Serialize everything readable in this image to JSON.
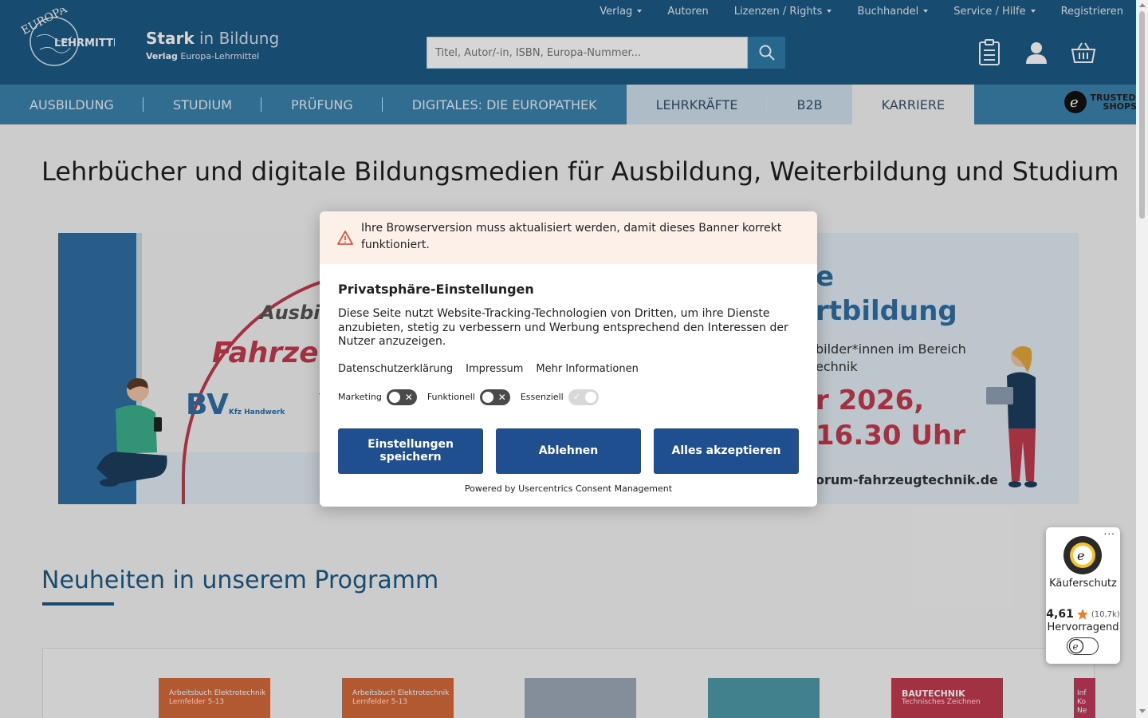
{
  "header": {
    "topnav": [
      {
        "label": "Verlag",
        "dropdown": true
      },
      {
        "label": "Autoren",
        "dropdown": false
      },
      {
        "label": "Lizenzen / Rights",
        "dropdown": true
      },
      {
        "label": "Buchhandel",
        "dropdown": true
      },
      {
        "label": "Service / Hilfe",
        "dropdown": true
      },
      {
        "label": "Registrieren",
        "dropdown": false
      }
    ],
    "logo_text": "EUROPA LEHRMITTEL",
    "brand_title_bold": "Stark",
    "brand_title_rest": " in Bildung",
    "brand_sub_bold": "Verlag",
    "brand_sub_rest": " Europa-Lehrmittel",
    "search_placeholder": "Titel, Autor/-in, ISBN, Europa-Nummer...",
    "icons": [
      "clipboard-icon",
      "user-icon",
      "cart-icon"
    ]
  },
  "mainnav": {
    "items": [
      "AUSBILDUNG",
      "STUDIUM",
      "PRÜFUNG",
      "DIGITALES: DIE EUROPATHEK"
    ],
    "light_items": [
      "LEHRKRÄFTE",
      "B2B"
    ],
    "white_items": [
      "KARRIERE"
    ],
    "trusted_line1": "TRUSTED",
    "trusted_line2": "SHOPS"
  },
  "page": {
    "title": "Lehrbücher und digitale Bildungsmedien für Ausbildung, Weiterbildung und Studium",
    "banner": {
      "left_line1": "Ausbil",
      "left_line2": "Fahrzeu",
      "left_logo1": "BV",
      "left_logo1_sub": "Kfz Handwerk",
      "left_logo2": "VC",
      "right_line1": "e",
      "right_line2": "rtbildung",
      "right_line3": "bilder*innen im Bereich",
      "right_line4": "echnik",
      "right_line5": "r 2026,",
      "right_line6": "16.30 Uhr",
      "right_line7": "orum-fahrzeugtechnik.de"
    },
    "section_title": "Neuheiten in unserem Programm",
    "products": [
      {
        "title": "Arbeitsbuch Elektrotechnik",
        "sub": "Lernfelder 5-13",
        "color": "#d46a3c"
      },
      {
        "title": "Arbeitsbuch Elektrotechnik",
        "sub": "Lernfelder 5-13",
        "color": "#d46a3c"
      },
      {
        "title": "",
        "sub": "",
        "color": "#9ea9b8"
      },
      {
        "title": "",
        "sub": "",
        "color": "#4e9aa8"
      },
      {
        "title": "BAUTECHNIK",
        "sub": "Technisches Zeichnen",
        "color": "#c23b4f"
      },
      {
        "title": "Inf Ko Ne",
        "sub": "",
        "color": "#c4395c"
      }
    ]
  },
  "consent": {
    "warning": "Ihre Browserversion muss aktualisiert werden, damit dieses Banner korrekt funktioniert.",
    "title": "Privatsphäre-Einstellungen",
    "description": "Diese Seite nutzt Website-Tracking-Technologien von Dritten, um ihre Dienste anzubieten, stetig zu verbessern und Werbung entsprechend den Interessen der Nutzer anzuzeigen.",
    "links": [
      "Datenschutzerklärung",
      "Impressum",
      "Mehr Informationen"
    ],
    "toggles": [
      {
        "label": "Marketing",
        "on": false
      },
      {
        "label": "Funktionell",
        "on": false
      },
      {
        "label": "Essenziell",
        "on": true
      }
    ],
    "buttons": {
      "save": "Einstellungen speichern",
      "reject": "Ablehnen",
      "accept": "Alles akzeptieren"
    },
    "powered": "Powered by Usercentrics Consent Management"
  },
  "trusted_widget": {
    "protection": "Käuferschutz",
    "score": "4,61",
    "count": "(10,7k)",
    "label": "Hervorragend",
    "menu": "..."
  },
  "colors": {
    "header": "#1d5a86",
    "nav": "#3a82ac",
    "button": "#1f4f8f",
    "accent_red": "#c23b4f"
  }
}
